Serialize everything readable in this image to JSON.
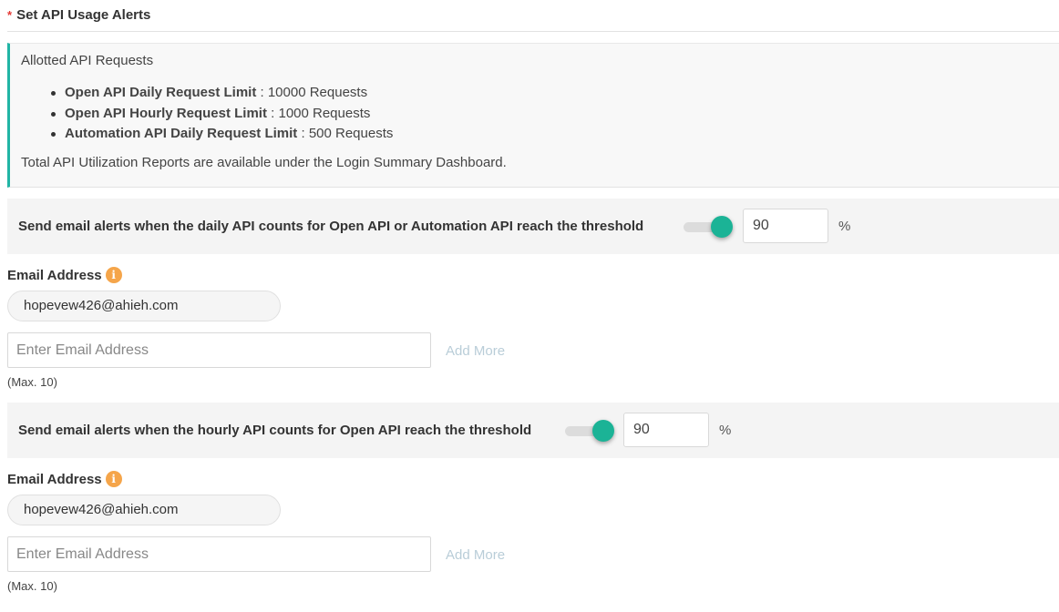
{
  "header": {
    "required_marker": "*",
    "title": "Set API Usage Alerts"
  },
  "info": {
    "heading": "Allotted API Requests",
    "items": [
      {
        "label": "Open API Daily Request Limit",
        "value": " : 10000 Requests"
      },
      {
        "label": "Open API Hourly Request Limit",
        "value": " : 1000 Requests"
      },
      {
        "label": "Automation API Daily Request Limit",
        "value": " : 500 Requests"
      }
    ],
    "footer": "Total API Utilization Reports are available under the Login Summary Dashboard."
  },
  "daily_alert": {
    "text": "Send email alerts when the daily API counts for Open API or Automation API reach the threshold",
    "enabled": true,
    "threshold": "90",
    "unit": "%",
    "email_label": "Email Address",
    "info_icon_glyph": "i",
    "email_chip": "hopevew426@ahieh.com",
    "email_placeholder": "Enter Email Address",
    "add_more": "Add More",
    "max_note": "(Max. 10)"
  },
  "hourly_alert": {
    "text": "Send email alerts when the hourly API counts for Open API reach the threshold",
    "enabled": true,
    "threshold": "90",
    "unit": "%",
    "email_label": "Email Address",
    "info_icon_glyph": "i",
    "email_chip": "hopevew426@ahieh.com",
    "email_placeholder": "Enter Email Address",
    "add_more": "Add More",
    "max_note": "(Max. 10)"
  },
  "colors": {
    "accent": "#1bb396",
    "info_border": "#21b5a5",
    "info_icon": "#f5a54a",
    "required": "#e53935",
    "add_more_link": "#b9cdd8"
  },
  "icons": {
    "info": "info-circle-icon"
  }
}
